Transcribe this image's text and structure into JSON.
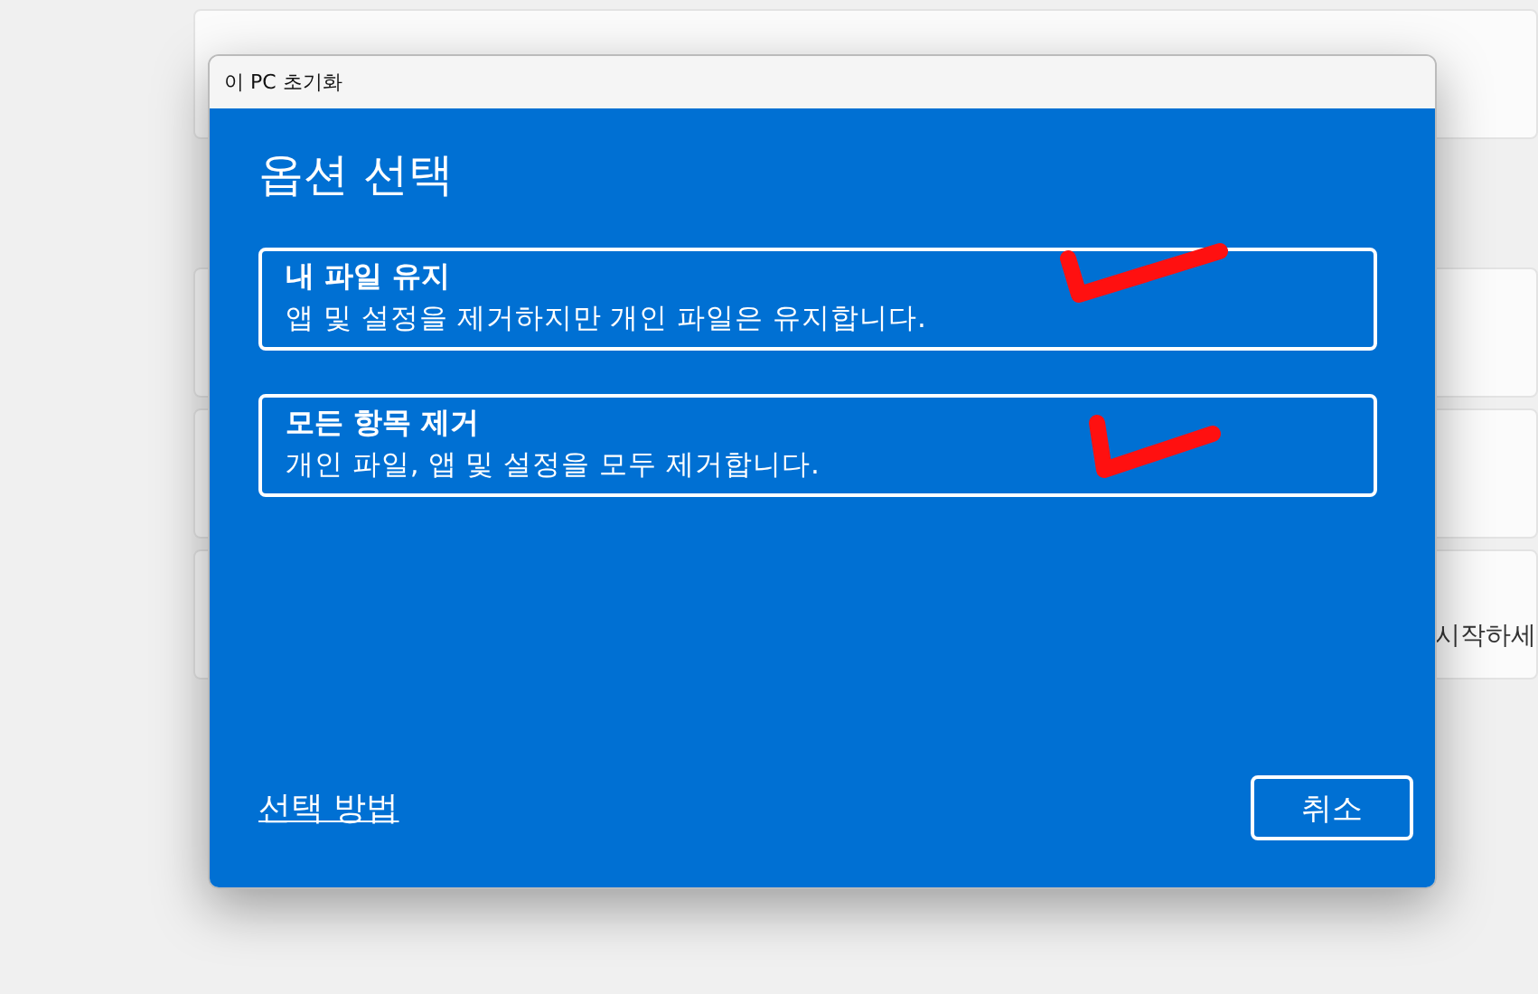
{
  "background": {
    "card_text": "시작하세"
  },
  "dialog": {
    "title": "이 PC 초기화",
    "heading": "옵션 선택",
    "options": [
      {
        "title": "내 파일 유지",
        "description": "앱 및 설정을 제거하지만 개인 파일은 유지합니다."
      },
      {
        "title": "모든 항목 제거",
        "description": "개인 파일, 앱 및 설정을 모두 제거합니다."
      }
    ],
    "help_link": "선택 방법",
    "cancel_button": "취소"
  }
}
